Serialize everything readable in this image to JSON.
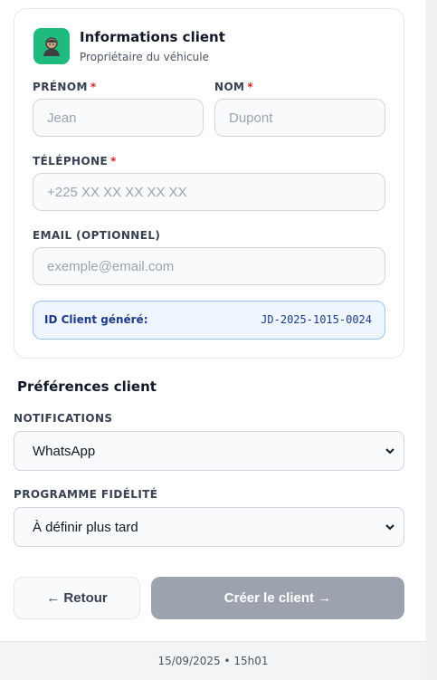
{
  "client_card": {
    "title": "Informations client",
    "subtitle": "Propriétaire du véhicule",
    "icon": "person-icon",
    "accent_color": "#1fba7e",
    "fields": {
      "first_name": {
        "label": "PRÉNOM",
        "required_mark": "*",
        "placeholder": "Jean",
        "value": ""
      },
      "last_name": {
        "label": "NOM",
        "required_mark": "*",
        "placeholder": "Dupont",
        "value": ""
      },
      "phone": {
        "label": "TÉLÉPHONE",
        "required_mark": "*",
        "placeholder": "+225 XX XX XX XX XX",
        "value": ""
      },
      "email": {
        "label": "EMAIL (OPTIONNEL)",
        "placeholder": "exemple@email.com",
        "value": ""
      }
    },
    "generated_id": {
      "label": "ID Client généré:",
      "value": "JD-2025-1015-0024"
    }
  },
  "preferences": {
    "title": "Préférences client",
    "notifications": {
      "label": "NOTIFICATIONS",
      "selected": "WhatsApp"
    },
    "loyalty": {
      "label": "PROGRAMME FIDÉLITÉ",
      "selected": "À définir plus tard"
    }
  },
  "actions": {
    "back_label": "← Retour",
    "create_label": "Créer le client →",
    "create_color": "#9ca3af"
  },
  "footer": {
    "datetime": "15/09/2025 • 15h01"
  }
}
